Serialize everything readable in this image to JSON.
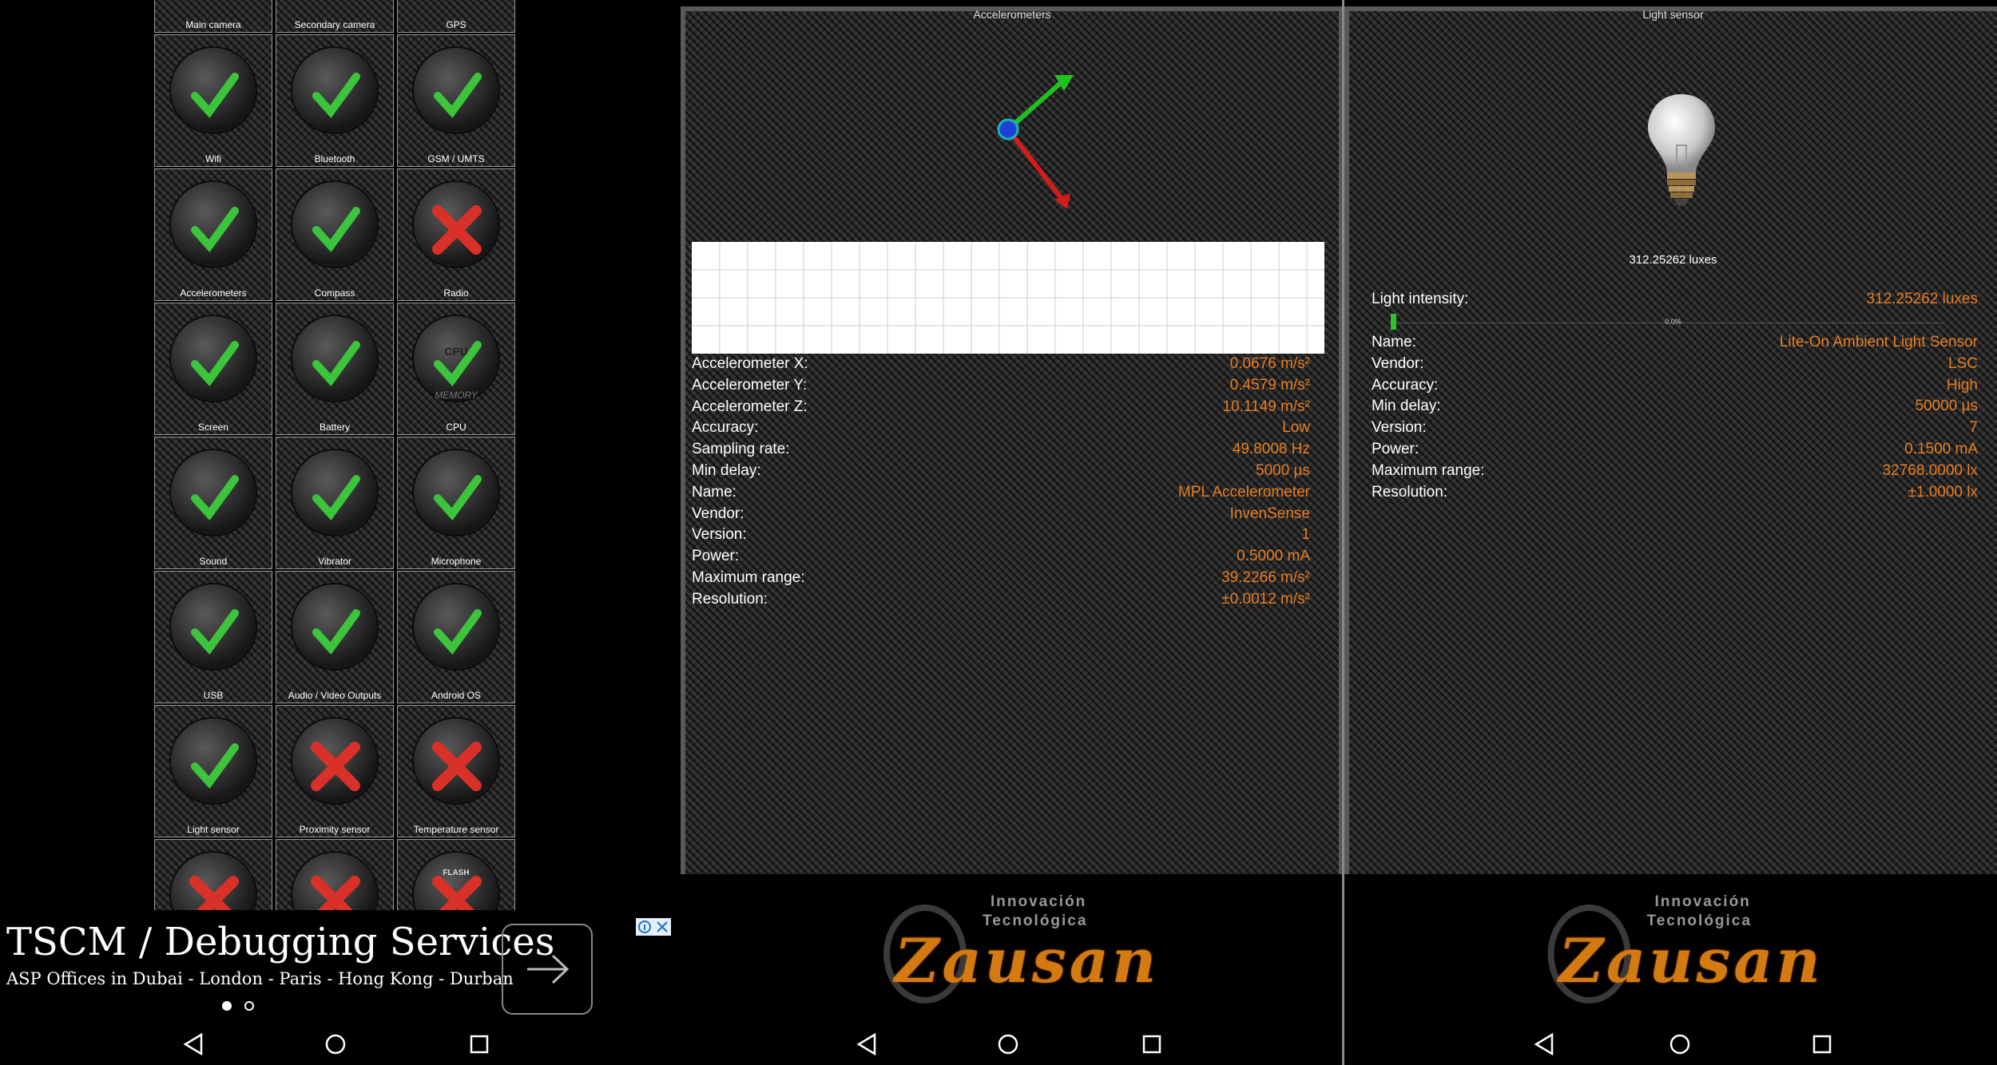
{
  "colors": {
    "accent": "#e67e22",
    "tile_border": "#9a9a9a",
    "check": "#3cc43c",
    "cross": "#d9302a"
  },
  "pane1": {
    "tiles": [
      {
        "label": "Main camera",
        "icon": "camera-icon",
        "status": "ok"
      },
      {
        "label": "Secondary camera",
        "icon": "camera-icon",
        "status": "ok"
      },
      {
        "label": "GPS",
        "icon": "gps-icon",
        "status": "ok"
      },
      {
        "label": "Wifi",
        "icon": "wifi-icon",
        "status": "ok"
      },
      {
        "label": "Bluetooth",
        "icon": "bluetooth-icon",
        "status": "ok"
      },
      {
        "label": "GSM / UMTS",
        "icon": "sim-card-icon",
        "status": "ok"
      },
      {
        "label": "Accelerometers",
        "icon": "gyroscope-icon",
        "status": "ok"
      },
      {
        "label": "Compass",
        "icon": "compass-icon",
        "status": "ok"
      },
      {
        "label": "Radio",
        "icon": "radio-icon",
        "status": "fail"
      },
      {
        "label": "Screen",
        "icon": "screen-icon",
        "status": "ok"
      },
      {
        "label": "Battery",
        "icon": "battery-icon",
        "status": "ok"
      },
      {
        "label": "CPU",
        "icon": "cpu-icon",
        "status": "ok"
      },
      {
        "label": "Sound",
        "icon": "speaker-icon",
        "status": "ok"
      },
      {
        "label": "Vibrator",
        "icon": "vibrator-icon",
        "status": "ok"
      },
      {
        "label": "Microphone",
        "icon": "microphone-icon",
        "status": "ok"
      },
      {
        "label": "USB",
        "icon": "usb-icon",
        "status": "ok"
      },
      {
        "label": "Audio / Video Outputs",
        "icon": "cable-icon",
        "status": "ok"
      },
      {
        "label": "Android OS",
        "icon": "android-icon",
        "status": "ok"
      },
      {
        "label": "Light sensor",
        "icon": "bulb-icon",
        "status": "ok"
      },
      {
        "label": "Proximity sensor",
        "icon": "proximity-icon",
        "status": "fail"
      },
      {
        "label": "Temperature sensor",
        "icon": "thermometer-icon",
        "status": "fail"
      },
      {
        "label": "",
        "icon": "pressure-gauge-icon",
        "status": "fail"
      },
      {
        "label": "",
        "icon": "gauge-icon",
        "status": "fail"
      },
      {
        "label": "",
        "icon": "flash-icon",
        "status": "fail"
      }
    ],
    "flash_text": "FLASH",
    "cpu_text": "CPU",
    "memory_text": "MEMORY",
    "ad": {
      "headline": "TSCM / Debugging Services",
      "subtext": "ASP Offices in Dubai - London - Paris - Hong Kong - Durban",
      "page_dots": [
        true,
        false
      ]
    }
  },
  "accelerometers": {
    "title": "Accelerometers",
    "rows": [
      {
        "k": "Accelerometer X:",
        "v": "0.0676 m/s²"
      },
      {
        "k": "Accelerometer Y:",
        "v": "0.4579 m/s²"
      },
      {
        "k": "Accelerometer Z:",
        "v": "10.1149 m/s²"
      },
      {
        "k": "Accuracy:",
        "v": "Low"
      },
      {
        "k": "Sampling rate:",
        "v": "49.8008 Hz"
      },
      {
        "k": "Min delay:",
        "v": "5000 µs"
      },
      {
        "k": "Name:",
        "v": "MPL Accelerometer"
      },
      {
        "k": "Vendor:",
        "v": "InvenSense"
      },
      {
        "k": "Version:",
        "v": "1"
      },
      {
        "k": "Power:",
        "v": "0.5000 mA"
      },
      {
        "k": "Maximum range:",
        "v": "39.2266 m/s²"
      },
      {
        "k": "Resolution:",
        "v": "±0.0012 m/s²"
      }
    ]
  },
  "light_sensor": {
    "title": "Light sensor",
    "reading": "312.25262 luxes",
    "intensity_label": "Light intensity:",
    "intensity_value": "312.25262 luxes",
    "bar_percent_label": "0.0%",
    "bar_fraction": 0.01,
    "rows": [
      {
        "k": "Name:",
        "v": "Lite-On Ambient Light Sensor"
      },
      {
        "k": "Vendor:",
        "v": "LSC"
      },
      {
        "k": "Accuracy:",
        "v": "High"
      },
      {
        "k": "Min delay:",
        "v": "50000 µs"
      },
      {
        "k": "Version:",
        "v": "7"
      },
      {
        "k": "Power:",
        "v": "0.1500 mA"
      },
      {
        "k": "Maximum range:",
        "v": "32768.0000 lx"
      },
      {
        "k": "Resolution:",
        "v": "±1.0000 lx"
      }
    ]
  },
  "logo": {
    "line1": "Innovación",
    "line2": "Tecnológica",
    "brand": "Zausan"
  }
}
